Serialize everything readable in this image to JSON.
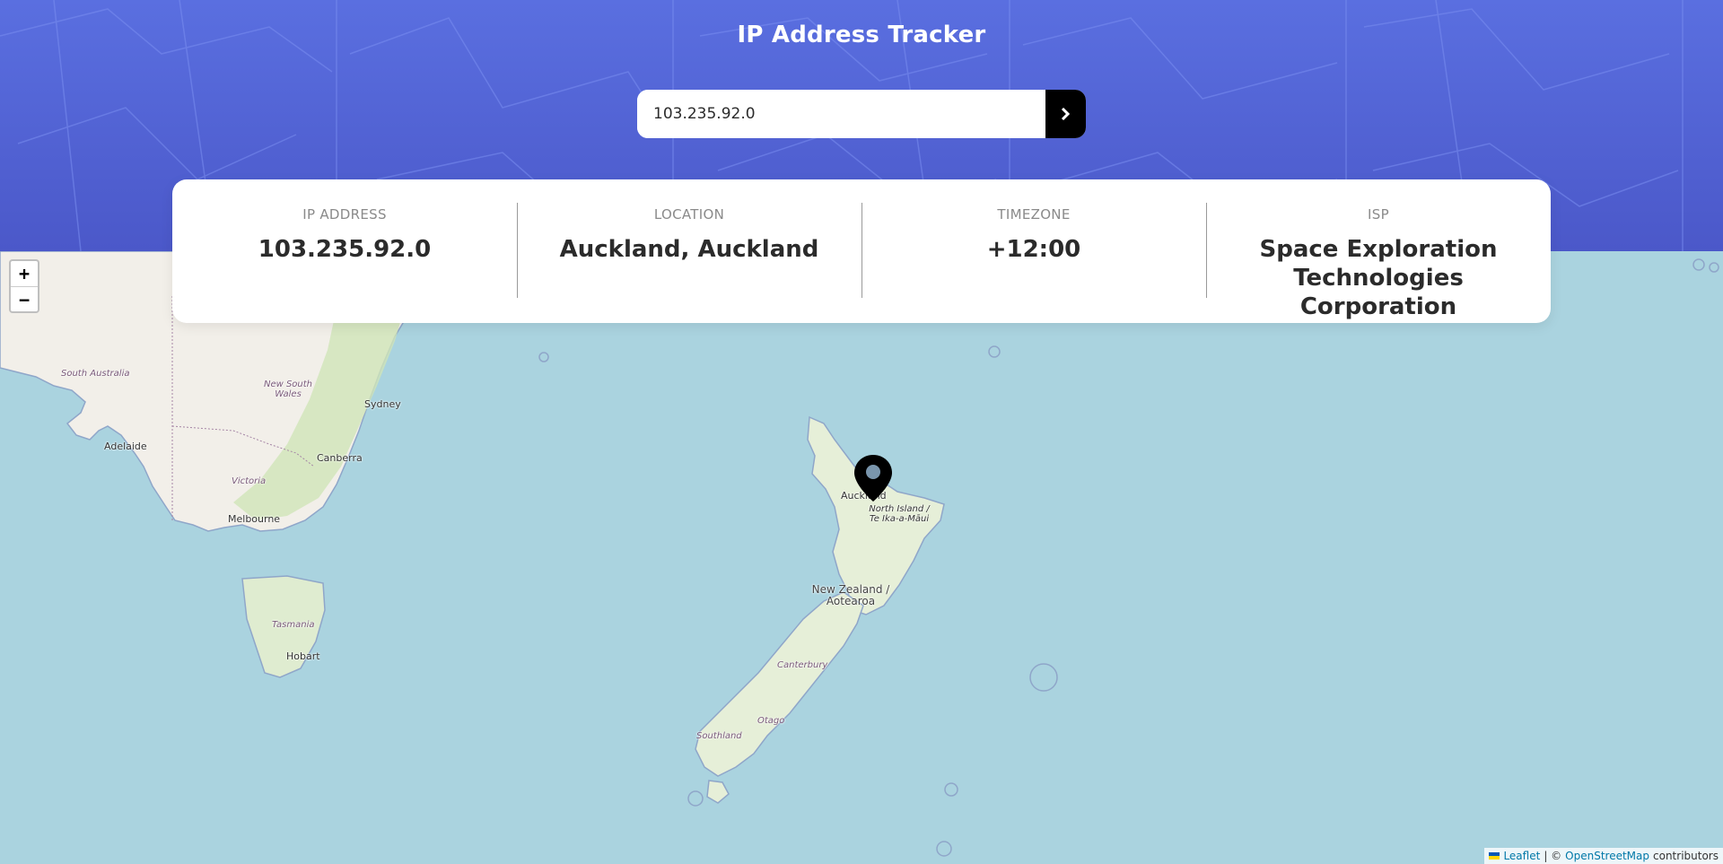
{
  "header": {
    "title": "IP Address Tracker"
  },
  "search": {
    "value": "103.235.92.0",
    "submit_icon": "chevron-right-icon"
  },
  "info": {
    "ip_label": "IP ADDRESS",
    "ip_value": "103.235.92.0",
    "location_label": "LOCATION",
    "location_value": "Auckland, Auckland",
    "timezone_label": "TIMEZONE",
    "timezone_value": "+12:00",
    "isp_label": "ISP",
    "isp_value": "Space Exploration Technologies Corporation"
  },
  "map": {
    "zoom_in": "+",
    "zoom_out": "−",
    "marker_icon": "location-pin-icon",
    "labels": {
      "south_australia": "South Australia",
      "new_south_wales": "New South Wales",
      "sydney": "Sydney",
      "adelaide": "Adelaide",
      "canberra": "Canberra",
      "victoria": "Victoria",
      "melbourne": "Melbourne",
      "tasmania": "Tasmania",
      "hobart": "Hobart",
      "auckland": "Auckland",
      "north_island": "North Island / Te Ika-a-Māui",
      "new_zealand": "New Zealand / Aotearoa",
      "canterbury": "Canterbury",
      "otago": "Otago",
      "southland": "Southland"
    },
    "attribution": {
      "leaflet": "Leaflet",
      "separator": "| ©",
      "osm": "OpenStreetMap",
      "suffix": "contributors"
    }
  },
  "colors": {
    "header_bg": "#5060d8",
    "water": "#aad3df",
    "land": "#f2efe9",
    "card_bg": "#ffffff",
    "button_bg": "#000000"
  }
}
